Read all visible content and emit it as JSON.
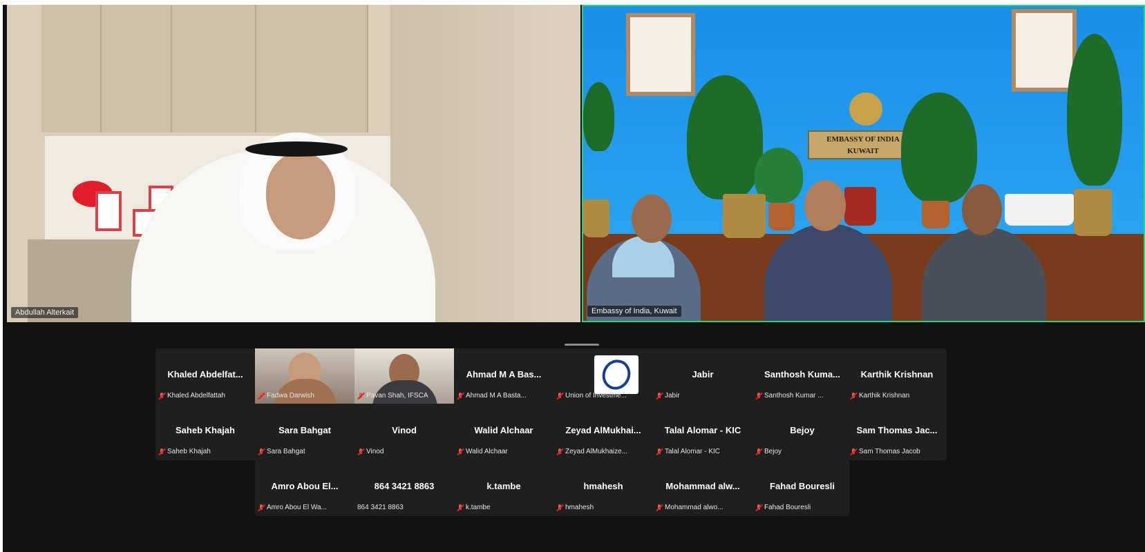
{
  "main_speakers": [
    {
      "name": "Abdullah Alterkait"
    },
    {
      "name": "Embassy of India, Kuwait",
      "plaque_line1": "EMBASSY OF INDIA",
      "plaque_line2": "KUWAIT"
    }
  ],
  "gallery": {
    "row1": [
      {
        "display": "Khaled Abdelfat...",
        "label": "Khaled Abdelfattah",
        "muted": true
      },
      {
        "display": "",
        "label": "Fadwa Darwish",
        "muted": true,
        "video": true
      },
      {
        "display": "",
        "label": "Pavan Shah, IFSCA",
        "muted": true,
        "video": true
      },
      {
        "display": "Ahmad M A Bas...",
        "label": "Ahmad M A Basta...",
        "muted": true
      },
      {
        "display": "",
        "label": "Union of Investme...",
        "muted": true,
        "logo": true
      },
      {
        "display": "Jabir",
        "label": "Jabir",
        "muted": true
      },
      {
        "display": "Santhosh Kuma...",
        "label": "Santhosh Kumar ...",
        "muted": true
      },
      {
        "display": "Karthik Krishnan",
        "label": "Karthik Krishnan",
        "muted": true
      }
    ],
    "row2": [
      {
        "display": "Saheb Khajah",
        "label": "Saheb Khajah",
        "muted": true
      },
      {
        "display": "Sara Bahgat",
        "label": "Sara Bahgat",
        "muted": true
      },
      {
        "display": "Vinod",
        "label": "Vinod",
        "muted": true
      },
      {
        "display": "Walid Alchaar",
        "label": "Walid Alchaar",
        "muted": true
      },
      {
        "display": "Zeyad AlMukhai...",
        "label": "Zeyad AlMukhaize...",
        "muted": true
      },
      {
        "display": "Talal Alomar - KIC",
        "label": "Talal Alomar - KIC",
        "muted": true
      },
      {
        "display": "Bejoy",
        "label": "Bejoy",
        "muted": true
      },
      {
        "display": "Sam Thomas Jac...",
        "label": "Sam Thomas Jacob",
        "muted": true
      }
    ],
    "row3": [
      {
        "display": "Amro Abou El...",
        "label": "Amro Abou El Wa...",
        "muted": true
      },
      {
        "display": "864 3421 8863",
        "label": "864 3421 8863",
        "muted": false
      },
      {
        "display": "k.tambe",
        "label": "k.tambe",
        "muted": true
      },
      {
        "display": "hmahesh",
        "label": "hmahesh",
        "muted": true
      },
      {
        "display": "Mohammad alw...",
        "label": "Mohammad alwo...",
        "muted": true
      },
      {
        "display": "Fahad Bouresli",
        "label": "Fahad Bouresli",
        "muted": true
      }
    ]
  }
}
